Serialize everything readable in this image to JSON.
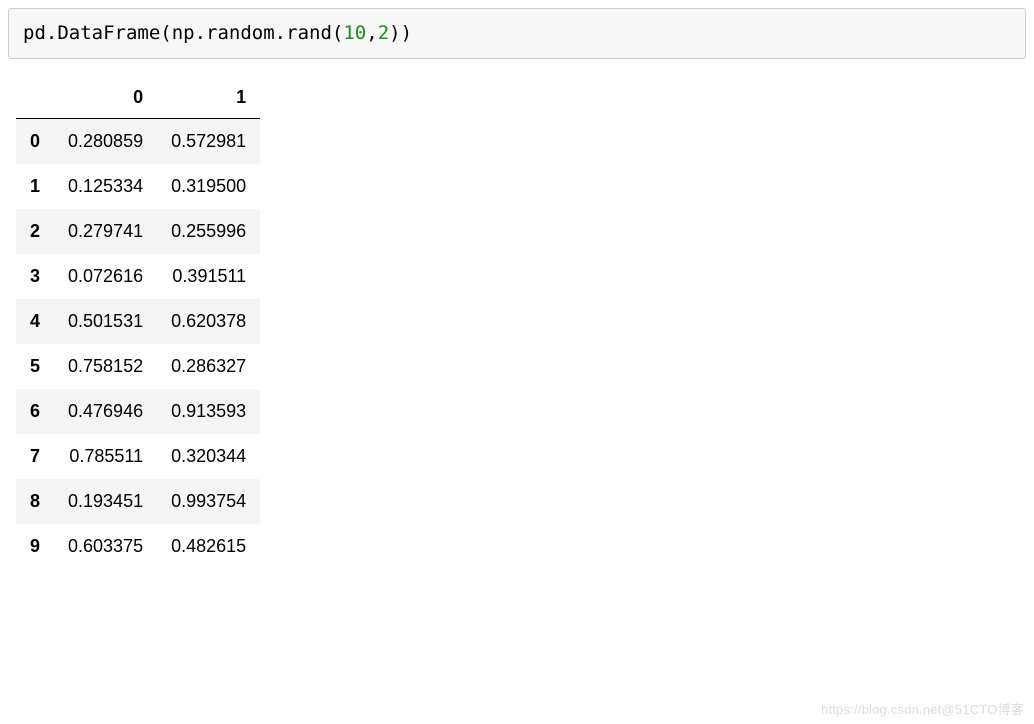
{
  "code_cell": {
    "tokens": [
      {
        "t": "pd.DataFrame",
        "cls": "tok-plain"
      },
      {
        "t": "(",
        "cls": "tok-paren"
      },
      {
        "t": "np.random.rand",
        "cls": "tok-plain"
      },
      {
        "t": "(",
        "cls": "tok-paren"
      },
      {
        "t": "10",
        "cls": "tok-num"
      },
      {
        "t": ",",
        "cls": "tok-plain"
      },
      {
        "t": "2",
        "cls": "tok-num"
      },
      {
        "t": ")",
        "cls": "tok-paren"
      },
      {
        "t": ")",
        "cls": "tok-paren"
      }
    ]
  },
  "dataframe": {
    "columns": [
      "0",
      "1"
    ],
    "index": [
      "0",
      "1",
      "2",
      "3",
      "4",
      "5",
      "6",
      "7",
      "8",
      "9"
    ],
    "rows": [
      [
        "0.280859",
        "0.572981"
      ],
      [
        "0.125334",
        "0.319500"
      ],
      [
        "0.279741",
        "0.255996"
      ],
      [
        "0.072616",
        "0.391511"
      ],
      [
        "0.501531",
        "0.620378"
      ],
      [
        "0.758152",
        "0.286327"
      ],
      [
        "0.476946",
        "0.913593"
      ],
      [
        "0.785511",
        "0.320344"
      ],
      [
        "0.193451",
        "0.993754"
      ],
      [
        "0.603375",
        "0.482615"
      ]
    ]
  },
  "watermark": "https://blog.csdn.net@51CTO博客",
  "chart_data": {
    "type": "table",
    "title": "pandas DataFrame output",
    "columns": [
      "0",
      "1"
    ],
    "index": [
      0,
      1,
      2,
      3,
      4,
      5,
      6,
      7,
      8,
      9
    ],
    "values": [
      [
        0.280859,
        0.572981
      ],
      [
        0.125334,
        0.3195
      ],
      [
        0.279741,
        0.255996
      ],
      [
        0.072616,
        0.391511
      ],
      [
        0.501531,
        0.620378
      ],
      [
        0.758152,
        0.286327
      ],
      [
        0.476946,
        0.913593
      ],
      [
        0.785511,
        0.320344
      ],
      [
        0.193451,
        0.993754
      ],
      [
        0.603375,
        0.482615
      ]
    ]
  }
}
